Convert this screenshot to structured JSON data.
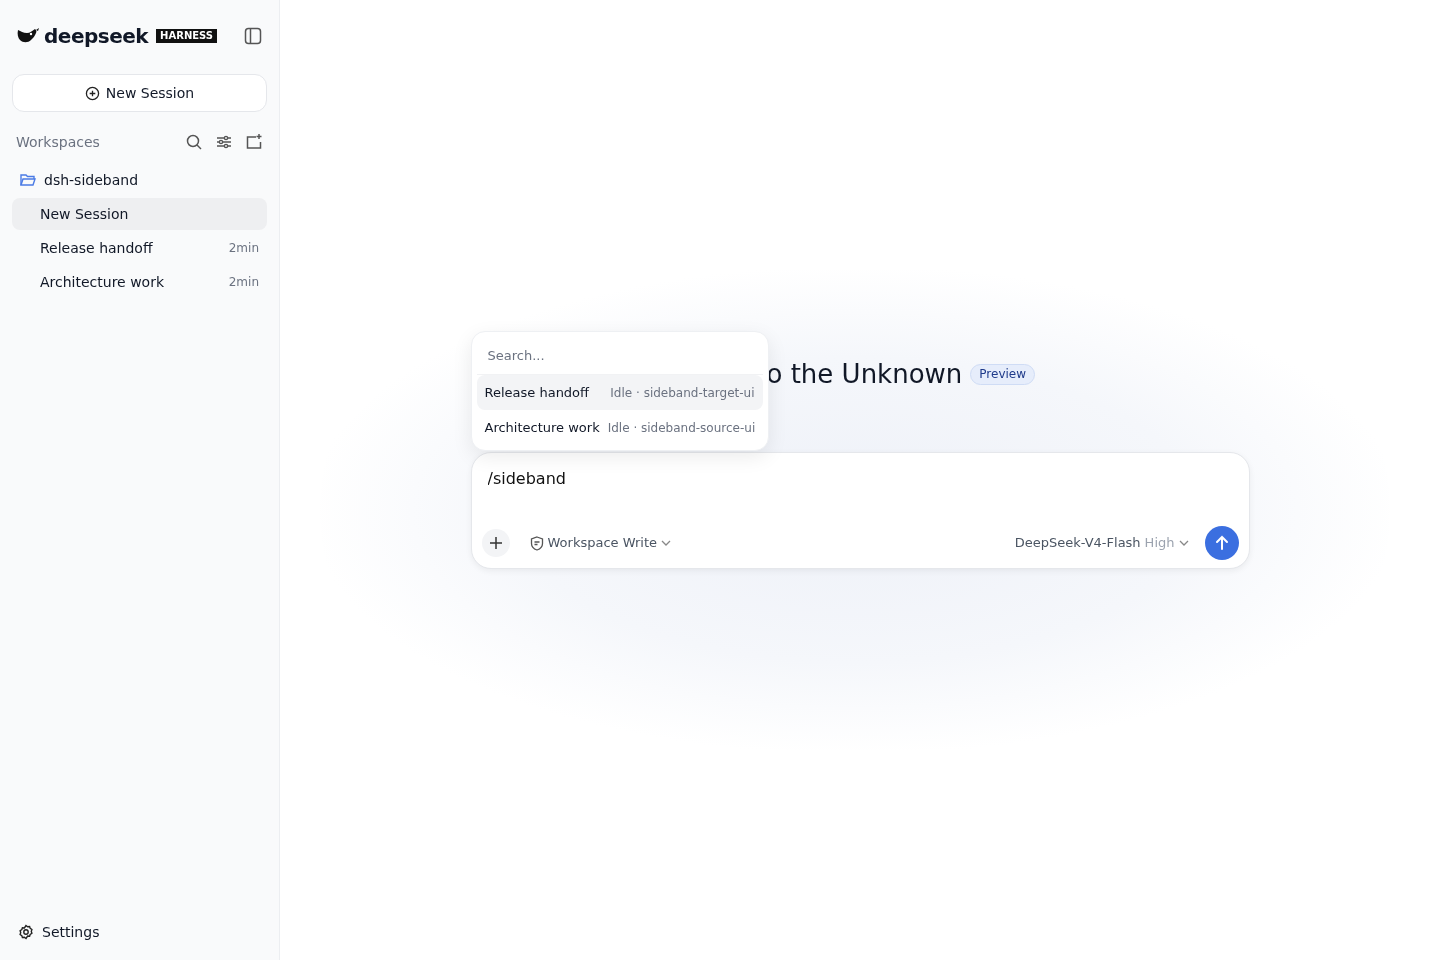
{
  "sidebar": {
    "brand": "deepseek",
    "brand_badge": "HARNESS",
    "new_session_button": "New Session",
    "workspaces_label": "Workspaces",
    "workspace": {
      "name": "dsh-sideband",
      "expanded": true,
      "sessions": [
        {
          "title": "New Session",
          "selected": true
        },
        {
          "title": "Release handoff",
          "time": "2min",
          "selected": false
        },
        {
          "title": "Architecture work",
          "time": "2min",
          "selected": false
        }
      ]
    },
    "settings": "Settings"
  },
  "main": {
    "heading": "o the Unknown",
    "heading_badge": "Preview",
    "session_picker": {
      "placeholder": "Search...",
      "items": [
        {
          "title": "Release handoff",
          "detail": "Idle · sideband-target-ui",
          "selected": true
        },
        {
          "title": "Architecture work",
          "detail": "Idle · sideband-source-ui",
          "selected": false
        }
      ]
    },
    "composer": {
      "value": "/sideband",
      "permission": "Workspace Write",
      "model": "DeepSeek-V4-Flash",
      "effort": "High"
    }
  }
}
